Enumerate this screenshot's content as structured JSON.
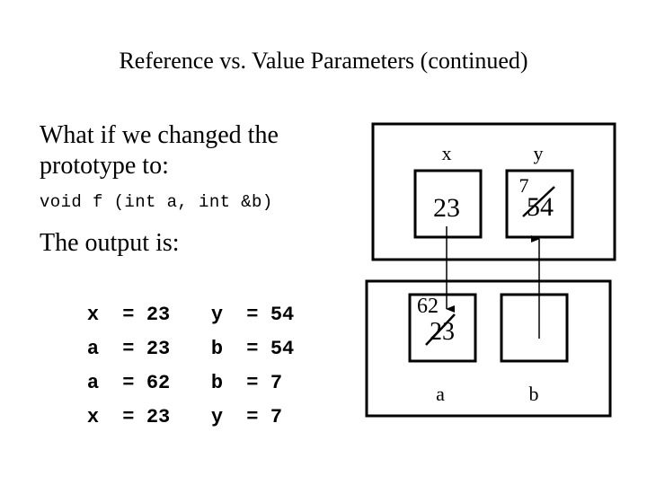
{
  "title": "Reference vs. Value Parameters (continued)",
  "intro_line1": "What if we changed the",
  "intro_line2": "prototype to:",
  "prototype_code": "void f (int a, int &b)",
  "output_label": "The output is:",
  "output_lines": [
    {
      "var1": "x",
      "eq": "=",
      "val1": "23",
      "var2": "y",
      "val2": "54"
    },
    {
      "var1": "a",
      "eq": "=",
      "val1": "23",
      "var2": "b",
      "val2": "54"
    },
    {
      "var1": "a",
      "eq": "=",
      "val1": "62",
      "var2": "b",
      "val2": "7"
    },
    {
      "var1": "x",
      "eq": "=",
      "val1": "23",
      "var2": "y",
      "val2": "7"
    }
  ],
  "diagram": {
    "caller_frame": {
      "x": {
        "label": "x",
        "value": "23"
      },
      "y": {
        "label": "y",
        "old_value": "54",
        "new_value": "7"
      }
    },
    "callee_frame": {
      "a": {
        "label": "a",
        "old_value": "23",
        "new_value": "62"
      },
      "b": {
        "label": "b",
        "value": ""
      }
    }
  }
}
